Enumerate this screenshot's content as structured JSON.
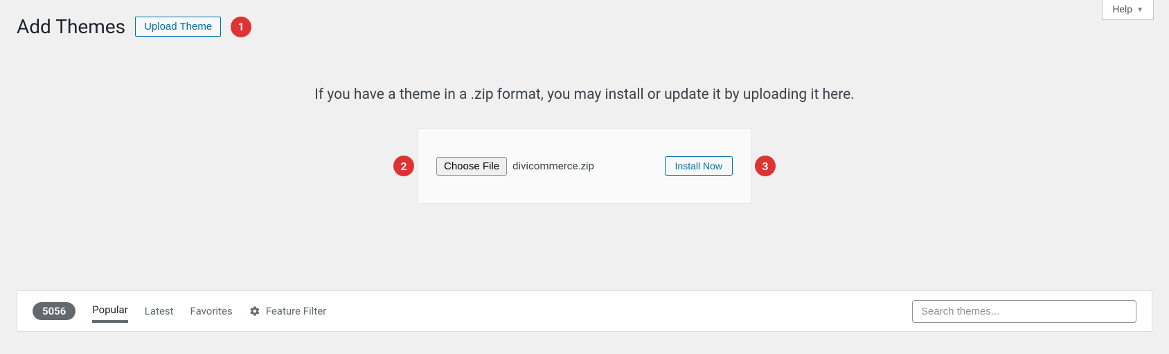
{
  "help": {
    "label": "Help"
  },
  "header": {
    "title": "Add Themes",
    "upload_button": "Upload Theme"
  },
  "markers": {
    "one": "1",
    "two": "2",
    "three": "3"
  },
  "upload": {
    "instructions": "If you have a theme in a .zip format, you may install or update it by uploading it here.",
    "choose_file": "Choose File",
    "file_name": "divicommerce.zip",
    "install_button": "Install Now"
  },
  "filter": {
    "count": "5056",
    "tabs": {
      "popular": "Popular",
      "latest": "Latest",
      "favorites": "Favorites",
      "feature_filter": "Feature Filter"
    },
    "search_placeholder": "Search themes..."
  }
}
